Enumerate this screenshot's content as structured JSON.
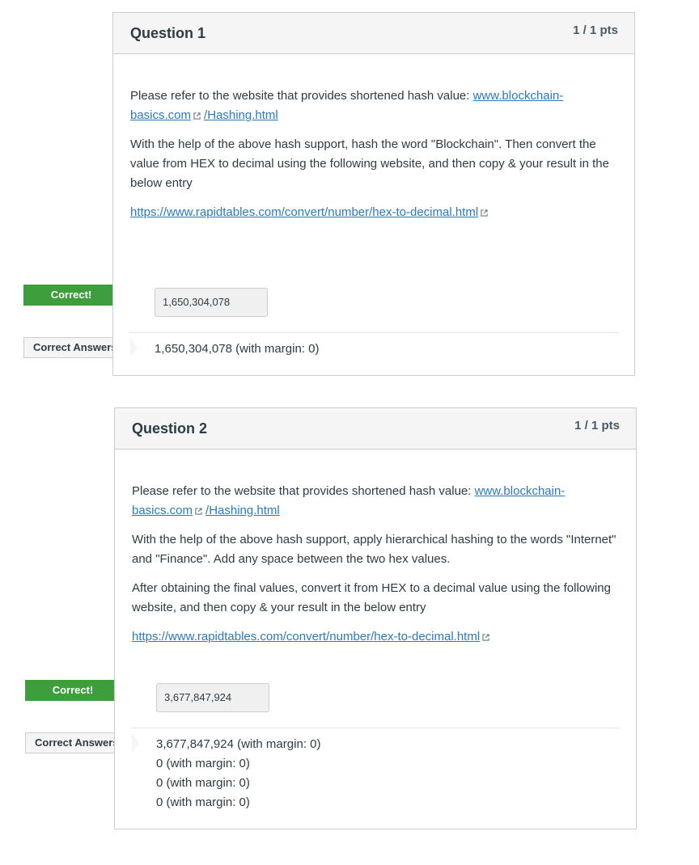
{
  "questions": [
    {
      "title": "Question 1",
      "points": "1 / 1 pts",
      "intro_text": "Please refer to the website that provides shortened hash value: ",
      "link1_part1": "www.blockchain-",
      "link1_part2": "basics.com",
      "link1_part3": "/Hashing.html",
      "para2": "With the help of the above hash support, hash the word \"Blockchain\". Then convert the value from HEX to decimal using the following website, and then copy & your result in the below entry",
      "link2": "https://www.rapidtables.com/convert/number/hex-to-decimal.html",
      "correct_flag": "Correct!",
      "answer_value": "1,650,304,078",
      "correct_answers_flag": "Correct Answers",
      "correct_answers": [
        "1,650,304,078 (with margin: 0)"
      ]
    },
    {
      "title": "Question 2",
      "points": "1 / 1 pts",
      "intro_text": "Please refer to the website that provides shortened hash value: ",
      "link1_part1": "www.blockchain-",
      "link1_part2": "basics.com",
      "link1_part3": "/Hashing.html",
      "para2": "With the help of the above hash support, apply hierarchical hashing to the words \"Internet\" and \"Finance\". Add any space between the two hex values.",
      "para3": "After obtaining the final values, convert it from HEX to a decimal value using the following website, and then copy & your result in the below entry",
      "link2": "https://www.rapidtables.com/convert/number/hex-to-decimal.html",
      "correct_flag": "Correct!",
      "answer_value": "3,677,847,924",
      "correct_answers_flag": "Correct Answers",
      "correct_answers": [
        "3,677,847,924 (with margin: 0)",
        "0 (with margin: 0)",
        "0 (with margin: 0)",
        "0 (with margin: 0)"
      ]
    }
  ]
}
